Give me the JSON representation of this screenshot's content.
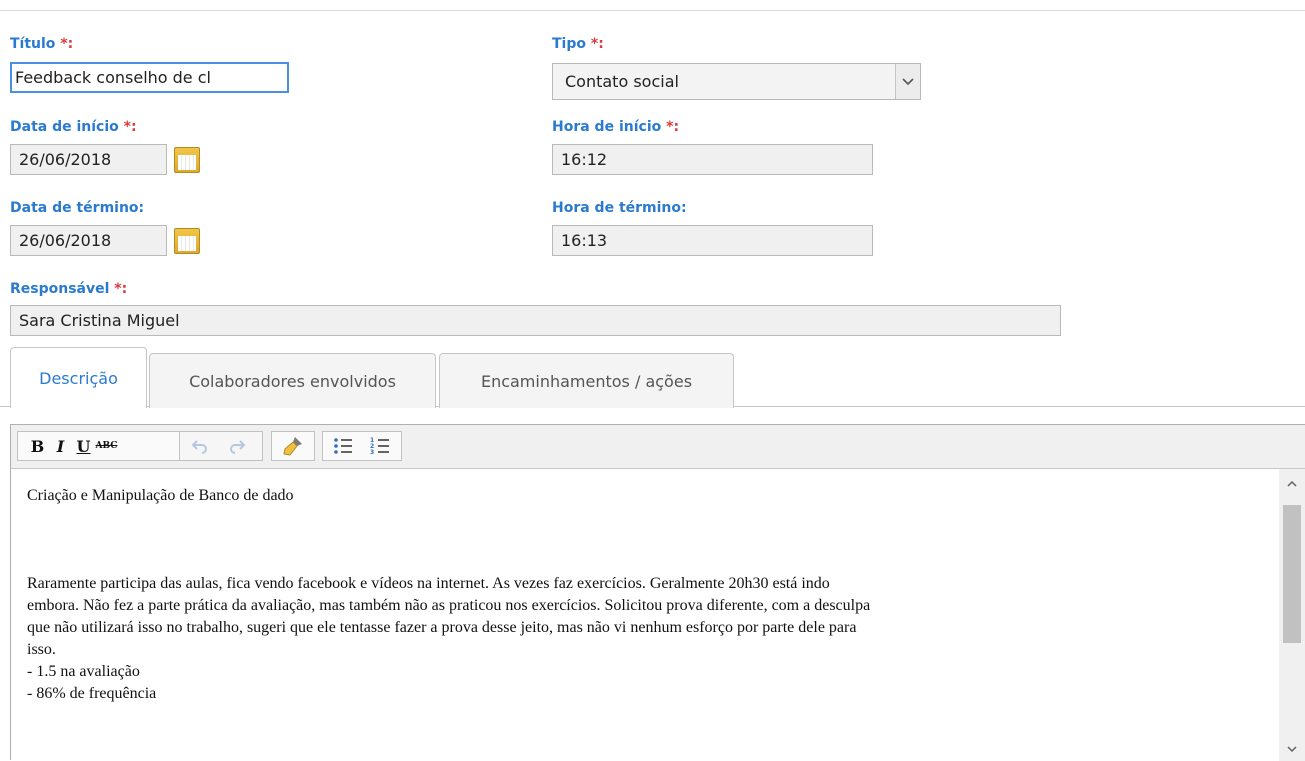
{
  "form": {
    "titulo": {
      "label": "Título",
      "req": "*",
      "colon": ":",
      "value": "Feedback conselho de cl"
    },
    "tipo": {
      "label": "Tipo",
      "req": "*",
      "colon": ":",
      "value": "Contato social"
    },
    "data_inicio": {
      "label": "Data de início",
      "req": "*",
      "colon": ":",
      "value": "26/06/2018"
    },
    "hora_inicio": {
      "label": "Hora de início",
      "req": "*",
      "colon": ":",
      "value": "16:12"
    },
    "data_termino": {
      "label": "Data de término:",
      "value": "26/06/2018"
    },
    "hora_termino": {
      "label": "Hora de término:",
      "value": "16:13"
    },
    "responsavel": {
      "label": "Responsável",
      "req": "*",
      "colon": ":",
      "value": "Sara Cristina Miguel"
    }
  },
  "tabs": [
    {
      "label": "Descrição",
      "active": true
    },
    {
      "label": "Colaboradores envolvidos",
      "active": false
    },
    {
      "label": "Encaminhamentos / ações",
      "active": false
    }
  ],
  "toolbar": {
    "bold": "B",
    "italic": "I",
    "underline": "U",
    "strike": "ABC",
    "icons": [
      "bold-icon",
      "italic-icon",
      "underline-icon",
      "strikethrough-icon",
      "undo-icon",
      "redo-icon",
      "clear-format-brush-icon",
      "bullet-list-icon",
      "numbered-list-icon"
    ]
  },
  "editor": {
    "lines": [
      "Criação e Manipulação de Banco de dado",
      "",
      "",
      "Raramente participa das aulas, fica vendo facebook e vídeos na internet. As vezes faz exercícios. Geralmente 20h30 está indo",
      "embora. Não fez a parte prática da avaliação, mas também não as praticou nos exercícios. Solicitou prova diferente, com a desculpa",
      "que não utilizará isso no trabalho, sugeri que ele tentasse fazer a prova desse jeito, mas não vi nenhum esforço por parte dele para",
      "isso.",
      "- 1.5 na avaliação",
      "- 86% de frequência"
    ]
  },
  "colors": {
    "label": "#2a7bd0",
    "required": "#d93b3b",
    "focus": "#4a8fe0"
  }
}
